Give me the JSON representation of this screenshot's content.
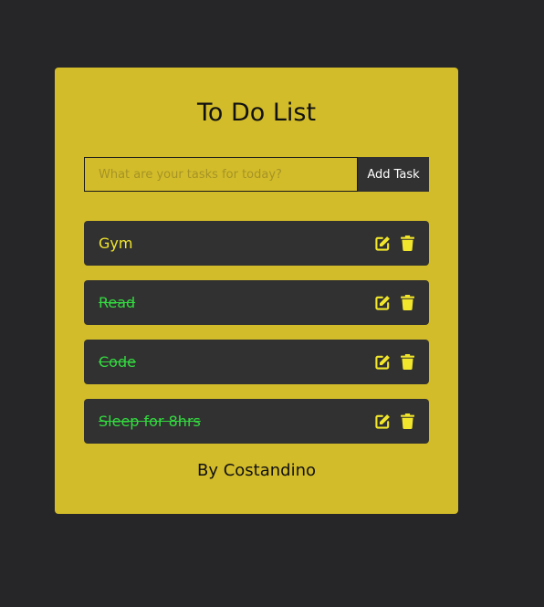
{
  "app": {
    "title": "To Do List",
    "footer": "By Costandino"
  },
  "form": {
    "placeholder": "What are your tasks for today?",
    "value": "",
    "add_label": "Add Task"
  },
  "tasks": [
    {
      "text": "Gym",
      "completed": false
    },
    {
      "text": "Read",
      "completed": true
    },
    {
      "text": "Code",
      "completed": true
    },
    {
      "text": "Sleep for 8hrs",
      "completed": true
    }
  ],
  "icons": {
    "edit": "edit-icon",
    "delete": "trash-icon"
  },
  "colors": {
    "page_background": "#262628",
    "card_background": "#d3bc2a",
    "task_background": "#313131",
    "task_text": "#f1e62b",
    "completed_text": "#33d93f",
    "icon": "#f1e62b"
  }
}
